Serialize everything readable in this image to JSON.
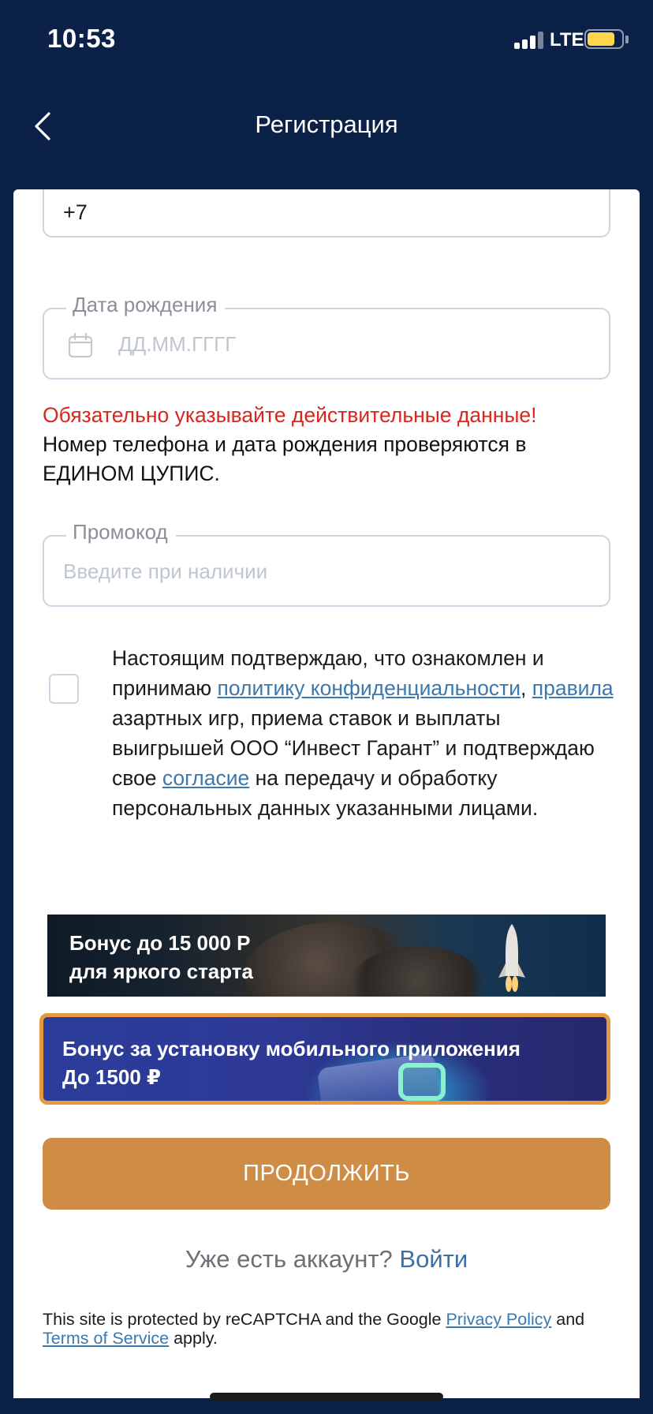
{
  "status_bar": {
    "time": "10:53",
    "network": "LTE",
    "icons": [
      "signal-icon",
      "battery-icon"
    ],
    "battery_level": 0.8,
    "battery_color": "#ffd54a"
  },
  "nav": {
    "back_icon": "chevron-left-icon",
    "title": "Регистрация"
  },
  "form": {
    "phone": {
      "value": "+7"
    },
    "birth_date": {
      "label": "Дата рождения",
      "placeholder": "ДД.ММ.ГГГГ",
      "icon": "calendar-icon"
    },
    "warning": {
      "highlight": "Обязательно указывайте действительные данные!",
      "text": "Номер телефона и дата рождения проверяются в ЕДИНОМ ЦУПИС."
    },
    "promo": {
      "label": "Промокод",
      "placeholder": "Введите при наличии"
    },
    "consent": {
      "checked": false,
      "text_1": "Настоящим подтверждаю, что ознакомлен и принимаю ",
      "link_privacy": "политику конфиденциальности",
      "text_2": ", ",
      "link_rules": "правила",
      "text_3": " азартных игр, приема ставок и выплаты выигрышей ООО “Инвест Гарант” и подтверждаю свое ",
      "link_consent": "согласие",
      "text_4": " на передачу и обработку персональных данных указанными лицами."
    }
  },
  "banners": [
    {
      "line1": "Бонус до 15 000 Р",
      "line2": "для яркого старта"
    },
    {
      "line1": "Бонус за установку мобильного приложения",
      "line2": "До 1500 ₽",
      "border_color": "#e59a42"
    }
  ],
  "continue_button": {
    "label": "ПРОДОЛЖИТЬ",
    "color": "#cf8c45"
  },
  "login_prompt": {
    "text": "Уже есть аккаунт?",
    "link": "Войти"
  },
  "recaptcha": {
    "text_1": "This site is protected by reCAPTCHA and the Google ",
    "privacy_link": "Privacy Policy",
    "text_2": " and ",
    "terms_link": "Terms of Service",
    "text_3": " apply."
  },
  "colors": {
    "header_bg": "#0b2148",
    "accent": "#cf8c45",
    "link": "#3d78ad",
    "error": "#d8271e"
  }
}
